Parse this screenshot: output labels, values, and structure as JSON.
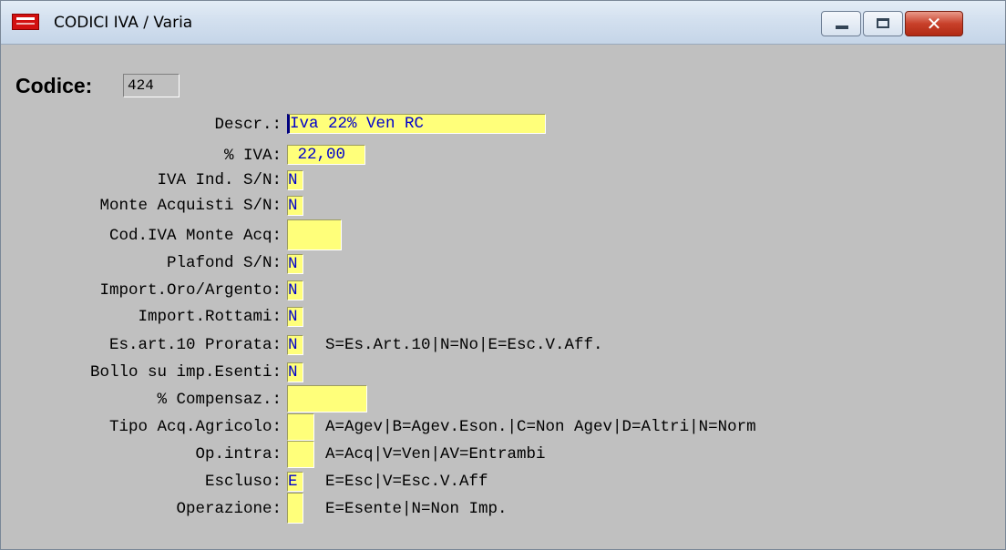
{
  "window": {
    "title": "CODICI IVA / Varia",
    "close_glyph": "✕"
  },
  "codice": {
    "label": "Codice:",
    "value": "424"
  },
  "fields": [
    {
      "label": "Descr.:",
      "value": "Iva 22% Ven RC",
      "hint": ""
    },
    {
      "label": "% IVA:",
      "value": " 22,00",
      "hint": ""
    },
    {
      "label": "IVA Ind. S/N:",
      "value": "N",
      "hint": ""
    },
    {
      "label": "Monte Acquisti S/N:",
      "value": "N",
      "hint": ""
    },
    {
      "label": "Cod.IVA Monte Acq:",
      "value": "",
      "hint": ""
    },
    {
      "label": "Plafond S/N:",
      "value": "N",
      "hint": ""
    },
    {
      "label": "Import.Oro/Argento:",
      "value": "N",
      "hint": ""
    },
    {
      "label": "Import.Rottami:",
      "value": "N",
      "hint": ""
    },
    {
      "label": "Es.art.10 Prorata:",
      "value": "N",
      "hint": "S=Es.Art.10|N=No|E=Esc.V.Aff."
    },
    {
      "label": "Bollo su imp.Esenti:",
      "value": "N",
      "hint": ""
    },
    {
      "label": "% Compensaz.:",
      "value": "",
      "hint": ""
    },
    {
      "label": "Tipo Acq.Agricolo:",
      "value": "",
      "hint": "A=Agev|B=Agev.Eson.|C=Non Agev|D=Altri|N=Norm"
    },
    {
      "label": "Op.intra:",
      "value": "",
      "hint": "A=Acq|V=Ven|AV=Entrambi"
    },
    {
      "label": "Escluso:",
      "value": "E",
      "hint": "E=Esc|V=Esc.V.Aff"
    },
    {
      "label": "Operazione:",
      "value": "",
      "hint": "E=Esente|N=Non Imp."
    }
  ]
}
